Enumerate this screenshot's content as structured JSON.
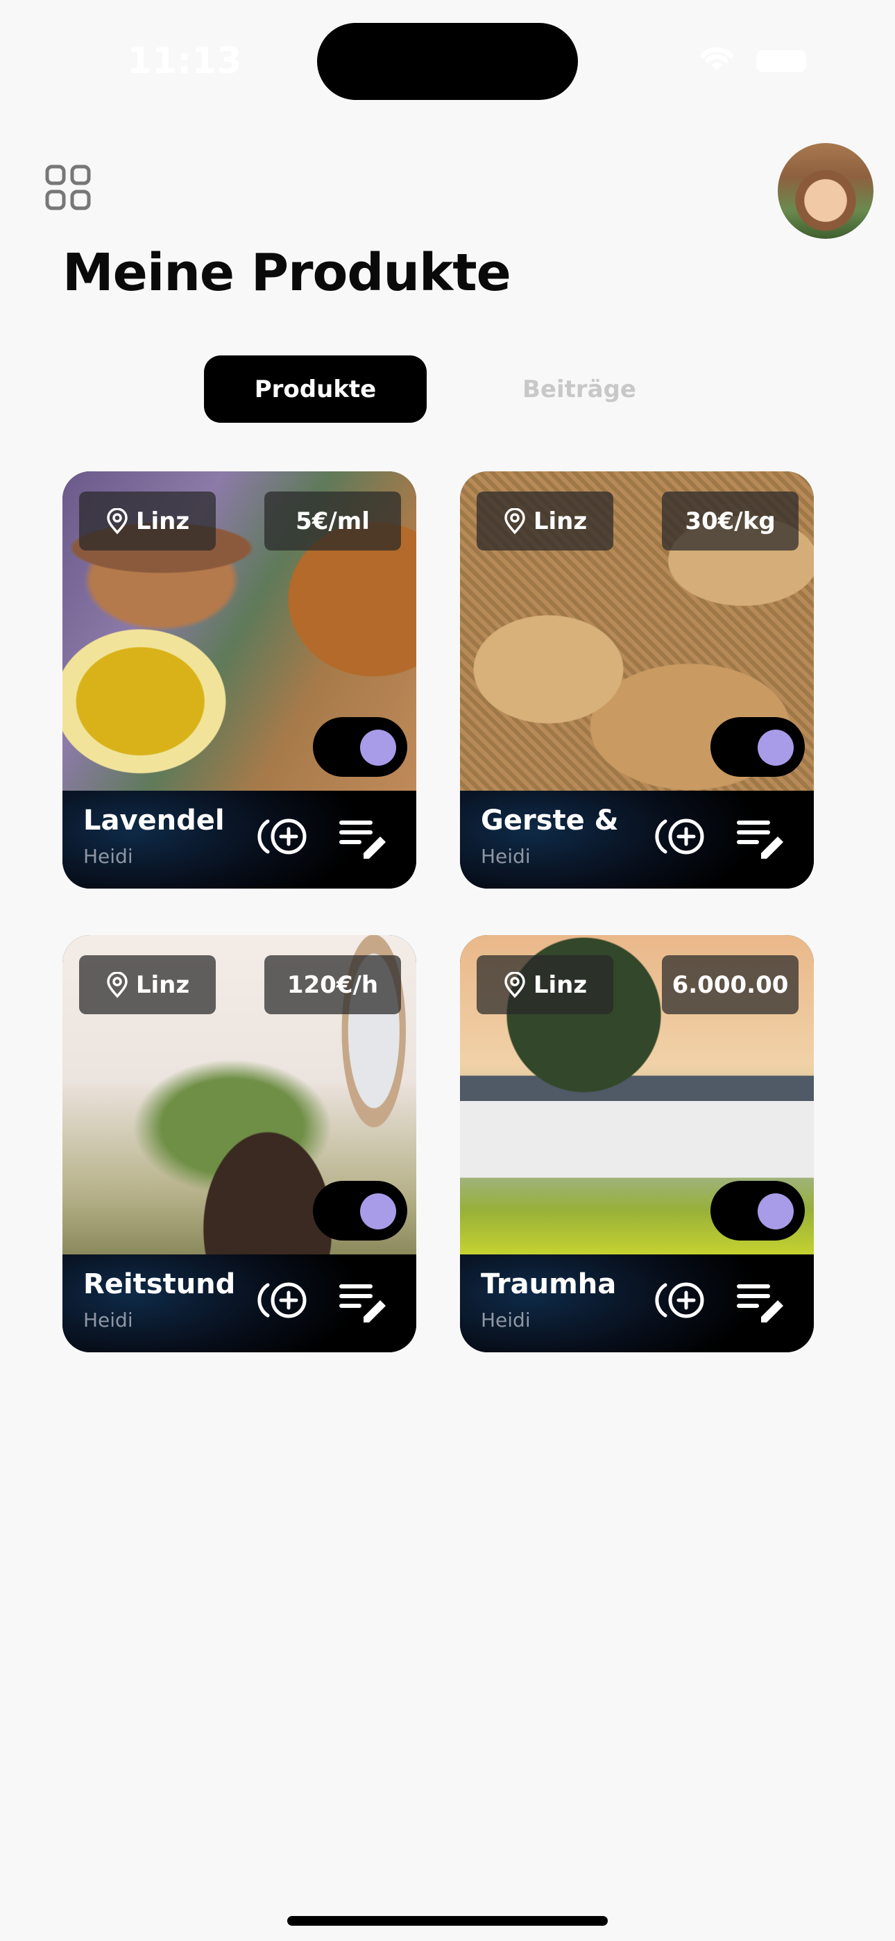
{
  "status_bar": {
    "time": "11:13"
  },
  "header": {
    "title": "Meine Produkte"
  },
  "tabs": [
    {
      "label": "Produkte",
      "active": true
    },
    {
      "label": "Beiträge",
      "active": false
    }
  ],
  "products": [
    {
      "location": "Linz",
      "price": "5€/ml",
      "name": "Lavendel",
      "owner": "Heidi",
      "active": true
    },
    {
      "location": "Linz",
      "price": "30€/kg",
      "name": "Gerste &",
      "owner": "Heidi",
      "active": true
    },
    {
      "location": "Linz",
      "price": "120€/h",
      "name": "Reitstund",
      "owner": "Heidi",
      "active": true
    },
    {
      "location": "Linz",
      "price": "6.000.00",
      "name": "Traumha",
      "owner": "Heidi",
      "active": true
    }
  ],
  "icons": {
    "menu": "grid-icon",
    "location": "pin-icon",
    "add": "add-circle-icon",
    "edit": "edit-list-icon"
  },
  "colors": {
    "toggle_knob": "#a89be8",
    "tab_active_bg": "#000000",
    "tab_inactive_text": "#c8c8c8"
  }
}
